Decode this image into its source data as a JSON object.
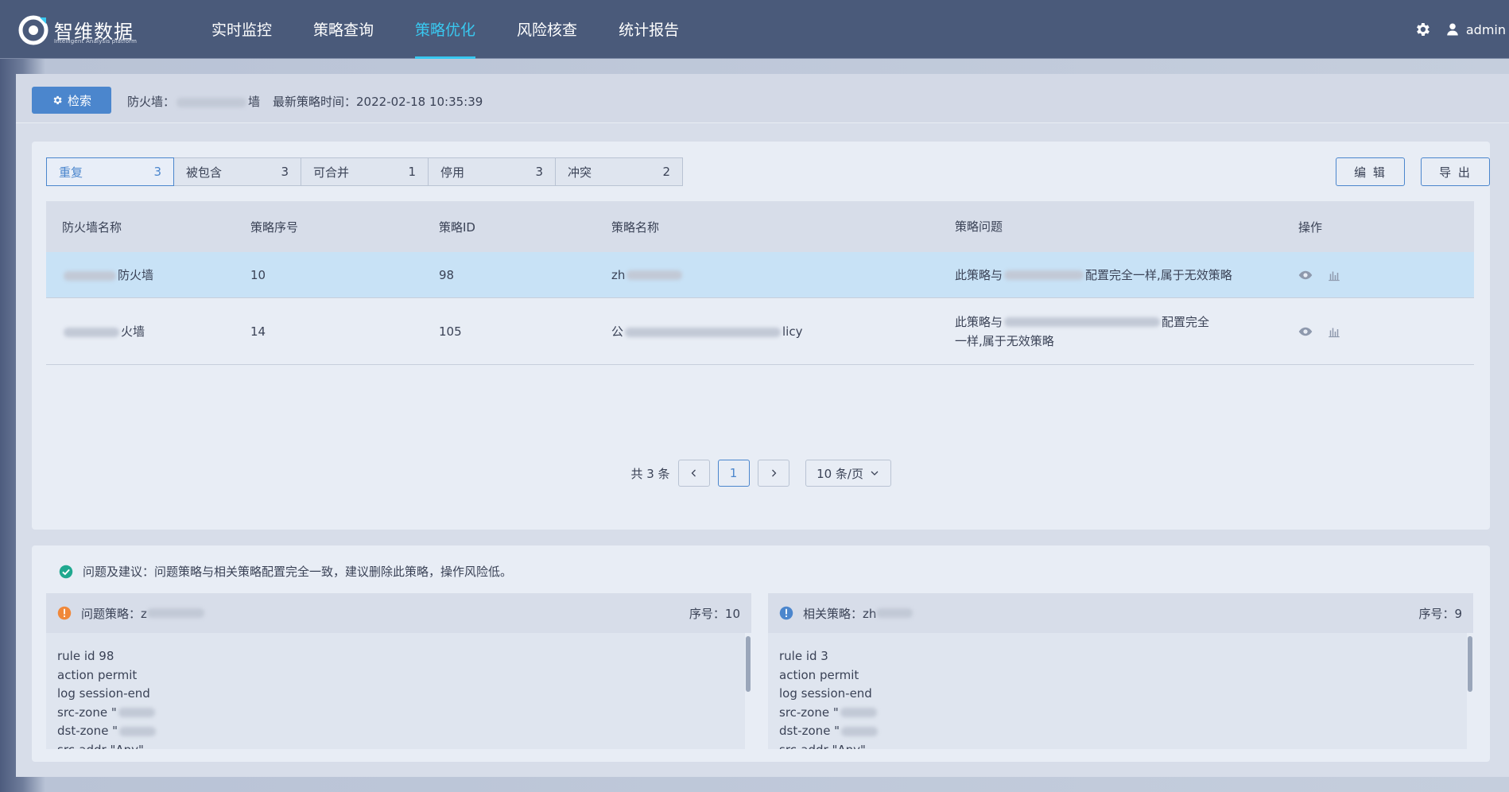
{
  "header": {
    "brand": "智维数据",
    "brand_sub": "Intelligent Analysis platform",
    "nav": [
      "实时监控",
      "策略查询",
      "策略优化",
      "风险核查",
      "统计报告"
    ],
    "active_nav_index": 2,
    "user": "admin",
    "accent": "#39c8f0",
    "icons": {
      "logo": "logo-icon",
      "settings": "gear-icon",
      "user": "user-icon"
    }
  },
  "search": {
    "button_label": "检索",
    "firewall_label": "防火墙：",
    "firewall_suffix": "墙",
    "latest_time_label": "最新策略时间：",
    "latest_time": "2022-02-18 10:35:39"
  },
  "tabs": [
    {
      "label": "重复",
      "count": "3"
    },
    {
      "label": "被包含",
      "count": "3"
    },
    {
      "label": "可合并",
      "count": "1"
    },
    {
      "label": "停用",
      "count": "3"
    },
    {
      "label": "冲突",
      "count": "2"
    }
  ],
  "actions": {
    "edit": "编 辑",
    "export": "导 出"
  },
  "table": {
    "headers": [
      "防火墙名称",
      "策略序号",
      "策略ID",
      "策略名称",
      "策略问题",
      "操作"
    ],
    "rows": [
      {
        "fw_name": "防火墙",
        "seq": "10",
        "id": "98",
        "name": "zh",
        "issue_prefix": "此策略与",
        "issue_suffix": "配置完全一样,属于无效策略"
      },
      {
        "fw_name": "火墙",
        "seq": "14",
        "id": "105",
        "name_prefix": "公",
        "name_suffix": "licy",
        "issue_prefix": "此策略与",
        "issue_mid": "配置完全",
        "issue_line2": "一样,属于无效策略"
      }
    ]
  },
  "pager": {
    "total": "共 3 条",
    "current": "1",
    "size": "10 条/页"
  },
  "suggestion": {
    "text": "问题及建议：问题策略与相关策略配置完全一致，建议删除此策略，操作风险低。",
    "problem": {
      "label": "问题策略：z",
      "seq_label": "序号：10",
      "code": [
        "rule id 98",
        "action permit",
        "log session-end",
        "src-zone \"",
        "dst-zone \"",
        "src-addr \"Any\""
      ]
    },
    "related": {
      "label": "相关策略：zh",
      "seq_label": "序号：9",
      "code": [
        "rule id 3",
        "action permit",
        "log session-end",
        "src-zone \"",
        "dst-zone \"",
        "src-addr \"Any\""
      ]
    }
  }
}
